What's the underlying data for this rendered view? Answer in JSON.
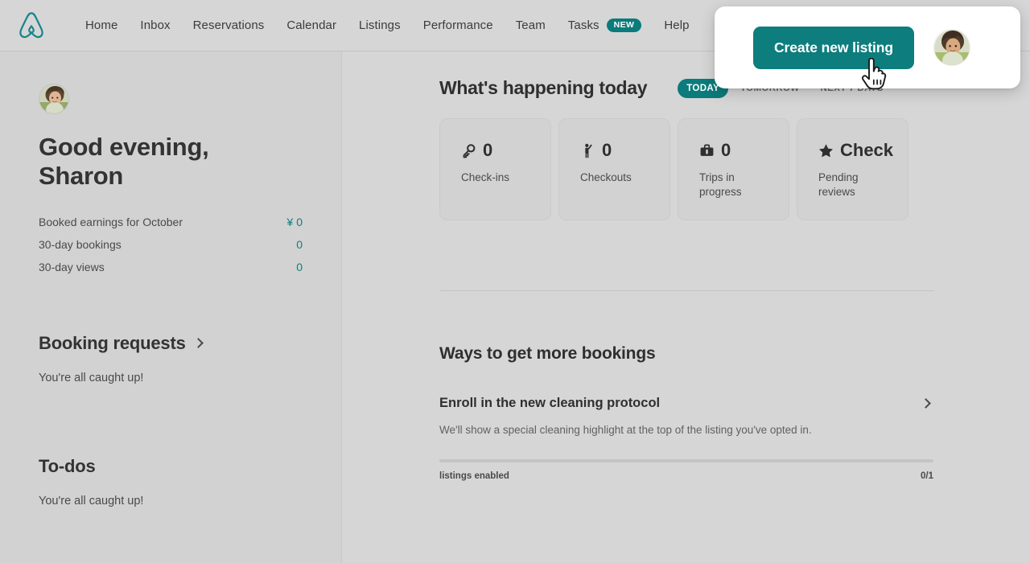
{
  "header": {
    "logo_name": "airbnb-logo",
    "logo_color": "#17868a",
    "nav": [
      {
        "label": "Home"
      },
      {
        "label": "Inbox"
      },
      {
        "label": "Reservations"
      },
      {
        "label": "Calendar"
      },
      {
        "label": "Listings"
      },
      {
        "label": "Performance"
      },
      {
        "label": "Team"
      },
      {
        "label": "Tasks",
        "badge": "NEW"
      },
      {
        "label": "Help"
      }
    ]
  },
  "popup": {
    "create_listing_label": "Create new listing",
    "button_color": "#0d7d7d",
    "avatar_name": "user-avatar",
    "cursor": "pointing-hand-cursor"
  },
  "sidebar": {
    "avatar_name": "host-avatar",
    "greeting_line1": "Good evening,",
    "greeting_line2": "Sharon",
    "greeting": "Good evening, Sharon",
    "stats": [
      {
        "label": "Booked earnings for October",
        "value": "¥ 0"
      },
      {
        "label": "30-day bookings",
        "value": "0"
      },
      {
        "label": "30-day views",
        "value": "0"
      }
    ],
    "stat_value_color": "#0e7e80",
    "booking_requests": {
      "title": "Booking requests",
      "empty_text": "You're all caught up!"
    },
    "todos": {
      "title": "To-dos",
      "empty_text": "You're all caught up!"
    }
  },
  "main": {
    "happening": {
      "title": "What's happening today",
      "segments": [
        {
          "label": "TODAY",
          "active": true
        },
        {
          "label": "TOMORROW",
          "active": false
        },
        {
          "label": "NEXT 7 DAYS",
          "active": false
        }
      ],
      "cards": [
        {
          "icon": "key-icon",
          "value": "0",
          "label": "Check-ins"
        },
        {
          "icon": "waving-person-icon",
          "value": "0",
          "label": "Checkouts"
        },
        {
          "icon": "briefcase-icon",
          "value": "0",
          "label": "Trips in progress"
        },
        {
          "icon": "star-icon",
          "value": "Check",
          "label": "Pending reviews"
        }
      ]
    },
    "ways": {
      "title": "Ways to get more bookings",
      "promo_title": "Enroll in the new cleaning protocol",
      "promo_desc": "We'll show a special cleaning highlight at the top of the listing you've opted in.",
      "progress_label": "listings enabled",
      "progress_value": "0/1",
      "progress_percent": 0
    }
  },
  "theme": {
    "accent": "#0b7b7b",
    "page_bg": "#d4d4d4",
    "sidebar_bg": "#d2d2d2",
    "card_bg": "#d2d2d2"
  }
}
